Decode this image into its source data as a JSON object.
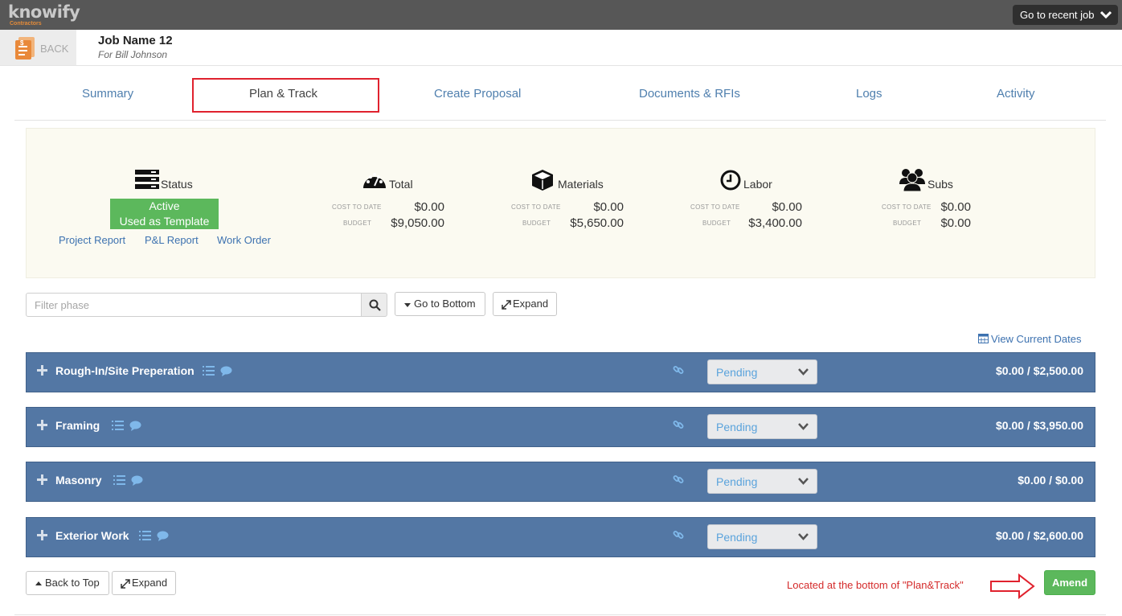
{
  "app": {
    "logo_text": "knowify",
    "logo_sub": "Contractors",
    "recent_job_label": "Go to recent job"
  },
  "header": {
    "back_label": "BACK",
    "job_name": "Job Name 12",
    "job_for": "For Bill Johnson"
  },
  "tabs": [
    {
      "label": "Summary",
      "active": false
    },
    {
      "label": "Plan & Track",
      "active": true
    },
    {
      "label": "Create Proposal",
      "active": false
    },
    {
      "label": "Documents & RFIs",
      "active": false
    },
    {
      "label": "Logs",
      "active": false
    },
    {
      "label": "Activity",
      "active": false
    }
  ],
  "summary": {
    "status": {
      "label": "Status",
      "badges": [
        "Active",
        "Used as Template"
      ],
      "links": [
        "Project Report",
        "P&L Report",
        "Work Order"
      ]
    },
    "cost_to_date_label": "COST TO DATE",
    "budget_label": "BUDGET",
    "columns": [
      {
        "label": "Total",
        "icon": "dashboard-icon",
        "cost_to_date": "$0.00",
        "budget": "$9,050.00"
      },
      {
        "label": "Materials",
        "icon": "cube-icon",
        "cost_to_date": "$0.00",
        "budget": "$5,650.00"
      },
      {
        "label": "Labor",
        "icon": "clock-icon",
        "cost_to_date": "$0.00",
        "budget": "$3,400.00"
      },
      {
        "label": "Subs",
        "icon": "users-icon",
        "cost_to_date": "$0.00",
        "budget": "$0.00"
      }
    ]
  },
  "toolbar": {
    "filter_placeholder": "Filter phase",
    "go_bottom_label": "Go to Bottom",
    "expand_label": "Expand",
    "view_dates_label": "View Current Dates"
  },
  "phases": [
    {
      "name": "Rough-In/Site Preperation",
      "status": "Pending",
      "amount": "$0.00 / $2,500.00"
    },
    {
      "name": "Framing",
      "status": "Pending",
      "amount": "$0.00 / $3,950.00"
    },
    {
      "name": "Masonry",
      "status": "Pending",
      "amount": "$0.00 / $0.00"
    },
    {
      "name": "Exterior Work",
      "status": "Pending",
      "amount": "$0.00 / $2,600.00"
    }
  ],
  "bottom": {
    "back_top_label": "Back to Top",
    "expand_label": "Expand",
    "annotation": "Located at the bottom of \"Plan&Track\"",
    "amend_label": "Amend"
  },
  "colors": {
    "topbar": "#575757",
    "phase_row": "#5377a4",
    "link": "#3d72b0",
    "success": "#5cb85c",
    "highlight": "#e0222e"
  }
}
